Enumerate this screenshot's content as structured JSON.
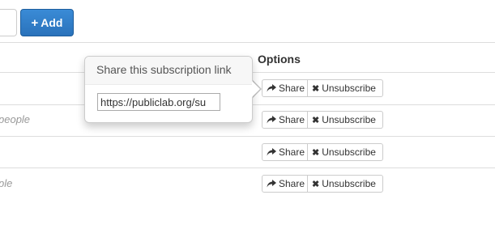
{
  "toolbar": {
    "add_label": "Add",
    "add_icon": "plus-icon"
  },
  "table": {
    "options_header": "Options",
    "rows": [
      {
        "text": "",
        "share_label": "Share",
        "unsubscribe_label": "Unsubscribe"
      },
      {
        "text": "people",
        "share_label": "Share",
        "unsubscribe_label": "Unsubscribe"
      },
      {
        "text": "",
        "share_label": "Share",
        "unsubscribe_label": "Unsubscribe"
      },
      {
        "text": "ple",
        "share_label": "Share",
        "unsubscribe_label": "Unsubscribe"
      }
    ]
  },
  "icons": {
    "share": "share-arrow-icon",
    "unsubscribe": "close-icon"
  },
  "popover": {
    "title": "Share this subscription link",
    "link_value": "https://publiclab.org/su"
  },
  "colors": {
    "add_button": "#2a72bb",
    "border": "#cccccc",
    "muted_text": "#999999"
  }
}
